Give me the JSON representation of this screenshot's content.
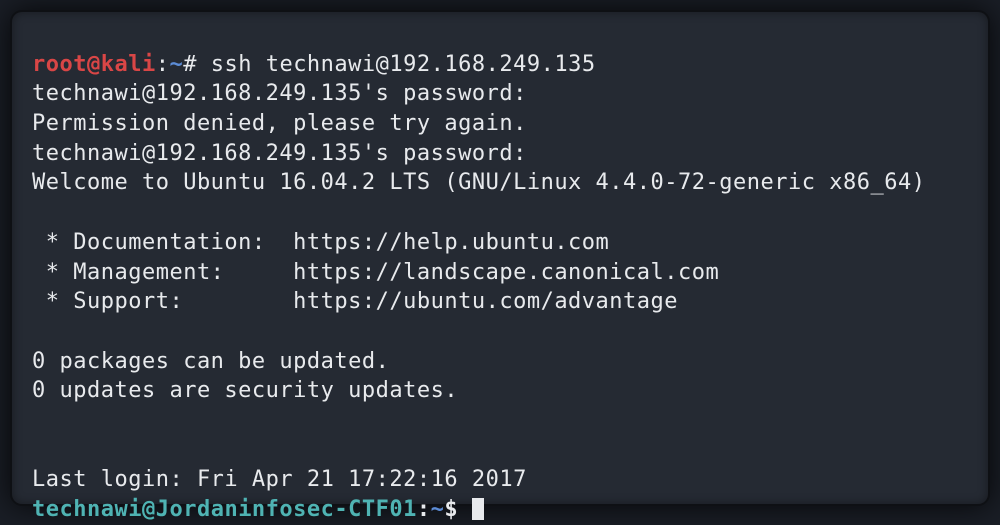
{
  "prompt1": {
    "user": "root",
    "at": "@",
    "host": "kali",
    "sep": ":",
    "cwd": "~",
    "hash": "#",
    "command": "ssh technawi@192.168.249.135"
  },
  "lines": {
    "pwprompt1": "technawi@192.168.249.135's password:",
    "denied": "Permission denied, please try again.",
    "pwprompt2": "technawi@192.168.249.135's password:",
    "welcome": "Welcome to Ubuntu 16.04.2 LTS (GNU/Linux 4.4.0-72-generic x86_64)",
    "doc": " * Documentation:  https://help.ubuntu.com",
    "mgmt": " * Management:     https://landscape.canonical.com",
    "support": " * Support:        https://ubuntu.com/advantage",
    "pk0": "0 packages can be updated.",
    "pk1": "0 updates are security updates.",
    "lastlogin": "Last login: Fri Apr 21 17:22:16 2017"
  },
  "prompt2": {
    "user": "technawi",
    "at": "@",
    "host": "Jordaninfosec-CTF01",
    "sep": ":",
    "cwd": "~",
    "dollar": "$"
  }
}
